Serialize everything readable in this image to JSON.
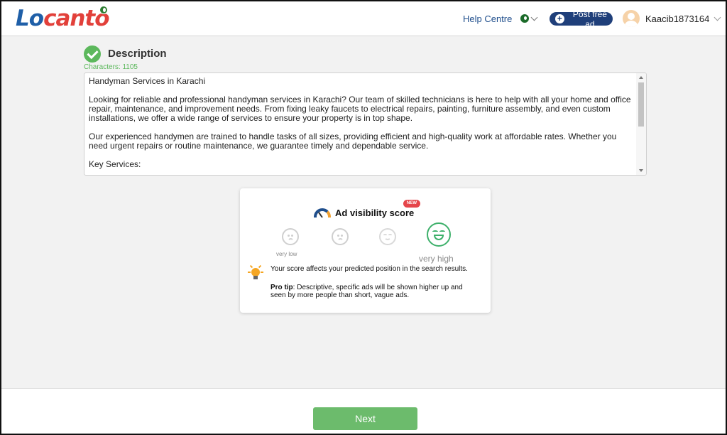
{
  "header": {
    "logo_text": "Locanto",
    "help_label": "Help Centre",
    "post_label": "Post free ad",
    "username": "Kaacib1873164"
  },
  "description": {
    "title": "Description",
    "char_count": "Characters: 1105",
    "text": "Handyman Services in Karachi\n\nLooking for reliable and professional handyman services in Karachi? Our team of skilled technicians is here to help with all your home and office repair, maintenance, and improvement needs. From fixing leaky faucets to electrical repairs, painting, furniture assembly, and even custom installations, we offer a wide range of services to ensure your property is in top shape.\n\nOur experienced handymen are trained to handle tasks of all sizes, providing efficient and high-quality work at affordable rates. Whether you need urgent repairs or routine maintenance, we guarantee timely and dependable service.\n\nKey Services:"
  },
  "visibility": {
    "badge": "NEW",
    "title": "Ad visibility score",
    "low_label": "very low",
    "high_label": "very high",
    "score_text": "Your score affects your predicted position in the search results.",
    "tip_label": "Pro tip",
    "tip_text": ": Descriptive, specific ads will be shown higher up and seen by more people than short, vague ads."
  },
  "footer": {
    "next_label": "Next"
  },
  "colors": {
    "brand_blue": "#1f5fa8",
    "brand_red": "#e2403a",
    "success": "#5cb85c",
    "post_btn": "#1f3f7a"
  }
}
